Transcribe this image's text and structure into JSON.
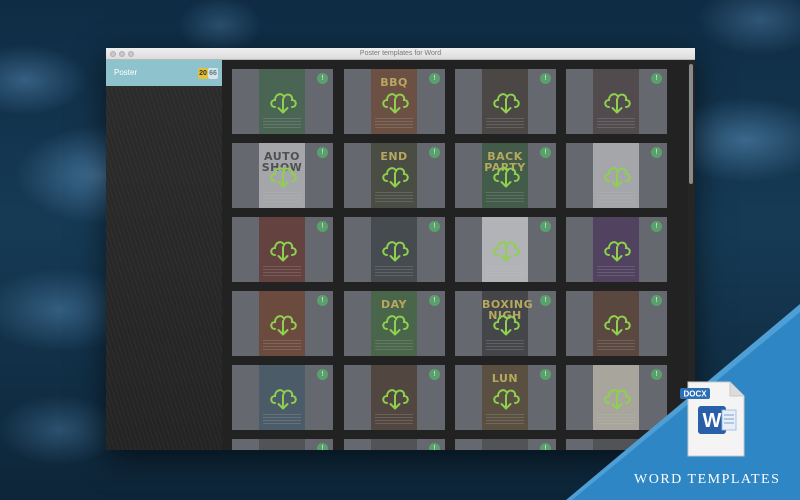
{
  "window": {
    "title": "Poster templates for Word"
  },
  "sidebar": {
    "items": [
      {
        "label": "Poster",
        "badge_primary": "20",
        "badge_secondary": "66"
      }
    ]
  },
  "colors": {
    "sidebar_selected": "#8ec2cc",
    "badge_primary": "#e3c23a",
    "download_icon_stroke": "#8fd14f",
    "banner_blue": "#2f86c4"
  },
  "grid": {
    "download_icon": "cloud-download-icon",
    "lock_icon": "lock-icon",
    "lock_glyph": "!",
    "tiles": [
      {
        "poster_text": "",
        "poster_color": "#2e5a35"
      },
      {
        "poster_text": "BBQ",
        "poster_color": "#6a3418"
      },
      {
        "poster_text": "",
        "poster_color": "#2d2418"
      },
      {
        "poster_text": "",
        "poster_color": "#3a2a2a"
      },
      {
        "poster_text": "AUTO SHOW",
        "poster_color": "#cfcfcf"
      },
      {
        "poster_text": "END",
        "poster_color": "#2a2e18"
      },
      {
        "poster_text": "BACK PARTY",
        "poster_color": "#1f4a24"
      },
      {
        "poster_text": "",
        "poster_color": "#cfcfcf"
      },
      {
        "poster_text": "",
        "poster_color": "#5a1a12"
      },
      {
        "poster_text": "",
        "poster_color": "#242a2c"
      },
      {
        "poster_text": "",
        "poster_color": "#e8e8e8"
      },
      {
        "poster_text": "",
        "poster_color": "#3a1a4a"
      },
      {
        "poster_text": "",
        "poster_color": "#6a2a10"
      },
      {
        "poster_text": "DAY",
        "poster_color": "#2a5a24"
      },
      {
        "poster_text": "BOXING NIGH",
        "poster_color": "#222222"
      },
      {
        "poster_text": "",
        "poster_color": "#4a2410"
      },
      {
        "poster_text": "",
        "poster_color": "#2e4a5a"
      },
      {
        "poster_text": "",
        "poster_color": "#3a2412"
      },
      {
        "poster_text": "LUN",
        "poster_color": "#4a3414"
      },
      {
        "poster_text": "",
        "poster_color": "#d8d0b8"
      },
      {
        "poster_text": "",
        "poster_color": "#3a3a3a"
      },
      {
        "poster_text": "",
        "poster_color": "#3a3a3a"
      },
      {
        "poster_text": "",
        "poster_color": "#3a3a3a"
      },
      {
        "poster_text": "",
        "poster_color": "#3a3a3a"
      }
    ]
  },
  "banner": {
    "doc_tag": "DOCX",
    "doc_letter": "W",
    "title": "WORD TEMPLATES"
  }
}
